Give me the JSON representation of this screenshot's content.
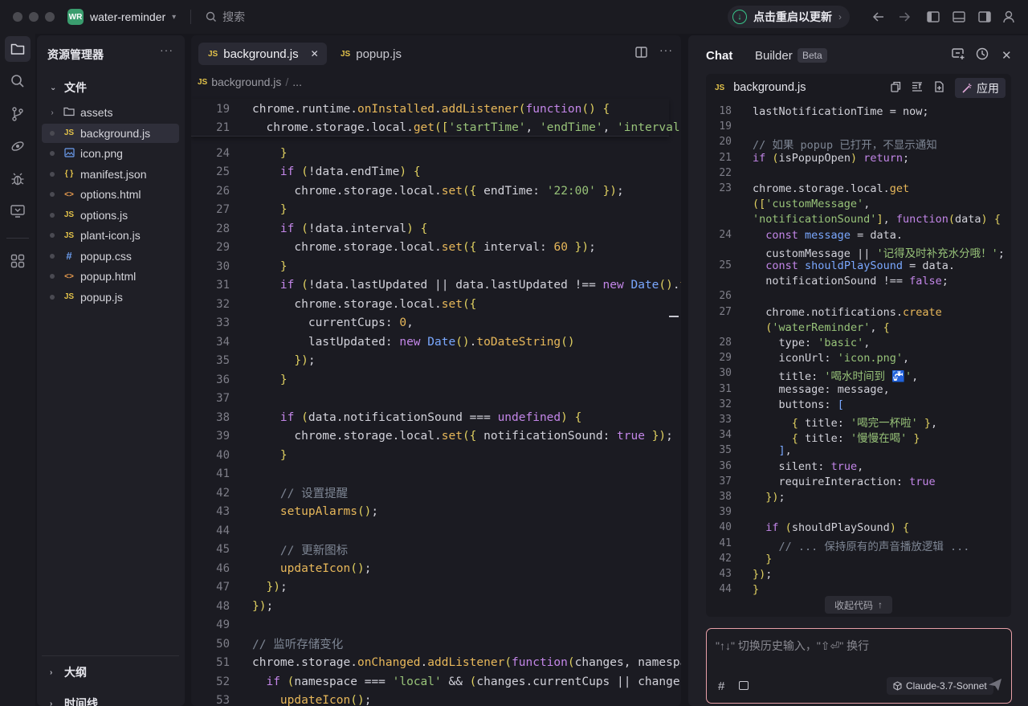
{
  "titlebar": {
    "project_badge": "WR",
    "project_name": "water-reminder",
    "search_placeholder": "搜索",
    "update_label": "点击重启以更新"
  },
  "sidebar": {
    "title": "资源管理器",
    "files_section": "文件",
    "outline_section": "大纲",
    "timeline_section": "时间线",
    "items": [
      {
        "name": "assets",
        "icon": "folder-icon"
      },
      {
        "name": "background.js",
        "icon": "js-file-icon"
      },
      {
        "name": "icon.png",
        "icon": "image-file-icon"
      },
      {
        "name": "manifest.json",
        "icon": "json-file-icon"
      },
      {
        "name": "options.html",
        "icon": "html-file-icon"
      },
      {
        "name": "options.js",
        "icon": "js-file-icon"
      },
      {
        "name": "plant-icon.js",
        "icon": "js-file-icon"
      },
      {
        "name": "popup.css",
        "icon": "css-file-icon"
      },
      {
        "name": "popup.html",
        "icon": "html-file-icon"
      },
      {
        "name": "popup.js",
        "icon": "js-file-icon"
      }
    ]
  },
  "editor": {
    "tabs": [
      {
        "label": "background.js",
        "badge": "JS"
      },
      {
        "label": "popup.js",
        "badge": "JS"
      }
    ],
    "breadcrumb": {
      "file": "background.js",
      "rest": "..."
    },
    "sticky": [
      {
        "ln": "19",
        "html": "<span class='v'>chrome</span>.<span class='v'>runtime</span>.<span class='f'>onInstalled</span>.<span class='f'>addListener</span><span class='p'>(</span><span class='k'>function</span><span class='p'>()</span> <span class='p'>{</span>"
      },
      {
        "ln": "21",
        "html": "  <span class='v'>chrome</span>.<span class='v'>storage</span>.<span class='v'>local</span>.<span class='f'>get</span><span class='p'>([</span><span class='s'>'startTime'</span>, <span class='s'>'endTime'</span>, <span class='s'>'interval'</span>"
      }
    ],
    "lines": [
      {
        "ln": "24",
        "html": "    <span class='p'>}</span>"
      },
      {
        "ln": "25",
        "html": "    <span class='k'>if</span> <span class='p'>(</span>!<span class='v'>data</span>.<span class='v'>endTime</span><span class='p'>)</span> <span class='p'>{</span>"
      },
      {
        "ln": "26",
        "html": "      <span class='v'>chrome</span>.<span class='v'>storage</span>.<span class='v'>local</span>.<span class='f'>set</span><span class='p'>({</span> <span class='v'>endTime</span>: <span class='s'>'22:00'</span> <span class='p'>})</span>;"
      },
      {
        "ln": "27",
        "html": "    <span class='p'>}</span>"
      },
      {
        "ln": "28",
        "html": "    <span class='k'>if</span> <span class='p'>(</span>!<span class='v'>data</span>.<span class='v'>interval</span><span class='p'>)</span> <span class='p'>{</span>"
      },
      {
        "ln": "29",
        "html": "      <span class='v'>chrome</span>.<span class='v'>storage</span>.<span class='v'>local</span>.<span class='f'>set</span><span class='p'>({</span> <span class='v'>interval</span>: <span class='n'>60</span> <span class='p'>})</span>;"
      },
      {
        "ln": "30",
        "html": "    <span class='p'>}</span>"
      },
      {
        "ln": "31",
        "html": "    <span class='k'>if</span> <span class='p'>(</span>!<span class='v'>data</span>.<span class='v'>lastUpdated</span> || <span class='v'>data</span>.<span class='v'>lastUpdated</span> !== <span class='k'>new</span> <span class='b'>Date</span><span class='p'>()</span>.<span class='f'>toD</span>"
      },
      {
        "ln": "32",
        "html": "      <span class='v'>chrome</span>.<span class='v'>storage</span>.<span class='v'>local</span>.<span class='f'>set</span><span class='p'>({</span>"
      },
      {
        "ln": "33",
        "html": "        <span class='v'>currentCups</span>: <span class='n'>0</span>,"
      },
      {
        "ln": "34",
        "html": "        <span class='v'>lastUpdated</span>: <span class='k'>new</span> <span class='b'>Date</span><span class='p'>()</span>.<span class='f'>toDateString</span><span class='p'>()</span>"
      },
      {
        "ln": "35",
        "html": "      <span class='p'>})</span>;"
      },
      {
        "ln": "36",
        "html": "    <span class='p'>}</span>"
      },
      {
        "ln": "37",
        "html": ""
      },
      {
        "ln": "38",
        "html": "    <span class='k'>if</span> <span class='p'>(</span><span class='v'>data</span>.<span class='v'>notificationSound</span> === <span class='k'>undefined</span><span class='p'>)</span> <span class='p'>{</span>"
      },
      {
        "ln": "39",
        "html": "      <span class='v'>chrome</span>.<span class='v'>storage</span>.<span class='v'>local</span>.<span class='f'>set</span><span class='p'>({</span> <span class='v'>notificationSound</span>: <span class='k'>true</span> <span class='p'>})</span>;"
      },
      {
        "ln": "40",
        "html": "    <span class='p'>}</span>"
      },
      {
        "ln": "41",
        "html": ""
      },
      {
        "ln": "42",
        "html": "    <span class='c'>// 设置提醒</span>"
      },
      {
        "ln": "43",
        "html": "    <span class='f'>setupAlarms</span><span class='p'>()</span>;"
      },
      {
        "ln": "44",
        "html": ""
      },
      {
        "ln": "45",
        "html": "    <span class='c'>// 更新图标</span>"
      },
      {
        "ln": "46",
        "html": "    <span class='f'>updateIcon</span><span class='p'>()</span>;"
      },
      {
        "ln": "47",
        "html": "  <span class='p'>})</span>;"
      },
      {
        "ln": "48",
        "html": "<span class='p'>})</span>;"
      },
      {
        "ln": "49",
        "html": ""
      },
      {
        "ln": "50",
        "html": "<span class='c'>// 监听存储变化</span>"
      },
      {
        "ln": "51",
        "html": "<span class='v'>chrome</span>.<span class='v'>storage</span>.<span class='f'>onChanged</span>.<span class='f'>addListener</span><span class='p'>(</span><span class='k'>function</span><span class='p'>(</span><span class='v'>changes</span>, <span class='v'>namespace</span>"
      },
      {
        "ln": "52",
        "html": "  <span class='k'>if</span> <span class='p'>(</span><span class='v'>namespace</span> === <span class='s'>'local'</span> &amp;&amp; <span class='p'>(</span><span class='v'>changes</span>.<span class='v'>currentCups</span> || <span class='v'>changes</span>.<span class='v'>c</span>"
      },
      {
        "ln": "53",
        "html": "    <span class='f'>updateIcon</span><span class='p'>()</span>;"
      }
    ]
  },
  "chat": {
    "tabs": [
      "Chat",
      "Builder"
    ],
    "beta_badge": "Beta",
    "card_filename": "background.js",
    "apply_label": "应用",
    "collapse_label": "收起代码",
    "input_placeholder": "\"↑↓\" 切换历史输入，\"⇧⏎\" 换行",
    "model": "Claude-3.7-Sonnet",
    "lines": [
      {
        "ln": "18",
        "html": "<span class='v'>lastNotificationTime</span> = <span class='v'>now</span>;"
      },
      {
        "ln": "19",
        "html": ""
      },
      {
        "ln": "20",
        "html": "<span class='c'>// 如果 popup 已打开，不显示通知</span>"
      },
      {
        "ln": "21",
        "html": "<span class='k'>if</span> <span class='p'>(</span><span class='v'>isPopupOpen</span><span class='p'>)</span> <span class='k'>return</span>;"
      },
      {
        "ln": "22",
        "html": ""
      },
      {
        "ln": "23",
        "html": "<span class='v'>chrome</span>.<span class='v'>storage</span>.<span class='v'>local</span>.<span class='f'>get</span>"
      },
      {
        "ln": "",
        "html": "<span class='p'>([</span><span class='s'>'customMessage'</span>,"
      },
      {
        "ln": "",
        "html": "<span class='s'>'notificationSound'</span><span class='p'>]</span>, <span class='k'>function</span><span class='p'>(</span><span class='v'>data</span><span class='p'>)</span> <span class='p'>{</span>"
      },
      {
        "ln": "24",
        "html": "  <span class='k'>const</span> <span class='b'>message</span> = <span class='v'>data</span>."
      },
      {
        "ln": "",
        "html": "  <span class='v'>customMessage</span> || <span class='s'>'记得及时补充水分哦！'</span>;"
      },
      {
        "ln": "25",
        "html": "  <span class='k'>const</span> <span class='b'>shouldPlaySound</span> = <span class='v'>data</span>."
      },
      {
        "ln": "",
        "html": "  <span class='v'>notificationSound</span> !== <span class='k'>false</span>;"
      },
      {
        "ln": "26",
        "html": ""
      },
      {
        "ln": "27",
        "html": "  <span class='v'>chrome</span>.<span class='v'>notifications</span>.<span class='f'>create</span>"
      },
      {
        "ln": "",
        "html": "  <span class='p'>(</span><span class='s'>'waterReminder'</span>, <span class='p'>{</span>"
      },
      {
        "ln": "28",
        "html": "    <span class='v'>type</span>: <span class='s'>'basic'</span>,"
      },
      {
        "ln": "29",
        "html": "    <span class='v'>iconUrl</span>: <span class='s'>'icon.png'</span>,"
      },
      {
        "ln": "30",
        "html": "    <span class='v'>title</span>: <span class='s'>'喝水时间到 🚰'</span>,"
      },
      {
        "ln": "31",
        "html": "    <span class='v'>message</span>: <span class='v'>message</span>,"
      },
      {
        "ln": "32",
        "html": "    <span class='v'>buttons</span>: <span class='b'>[</span>"
      },
      {
        "ln": "33",
        "html": "      <span class='p'>{</span> <span class='v'>title</span>: <span class='s'>'喝完一杯啦'</span> <span class='p'>}</span>,"
      },
      {
        "ln": "34",
        "html": "      <span class='p'>{</span> <span class='v'>title</span>: <span class='s'>'慢慢在喝'</span> <span class='p'>}</span>"
      },
      {
        "ln": "35",
        "html": "    <span class='b'>]</span>,"
      },
      {
        "ln": "36",
        "html": "    <span class='v'>silent</span>: <span class='k'>true</span>,"
      },
      {
        "ln": "37",
        "html": "    <span class='v'>requireInteraction</span>: <span class='k'>true</span>"
      },
      {
        "ln": "38",
        "html": "  <span class='p'>})</span>;"
      },
      {
        "ln": "39",
        "html": ""
      },
      {
        "ln": "40",
        "html": "  <span class='k'>if</span> <span class='p'>(</span><span class='v'>shouldPlaySound</span><span class='p'>)</span> <span class='p'>{</span>"
      },
      {
        "ln": "41",
        "html": "    <span class='c'>// ... 保持原有的声音播放逻辑 ...</span>"
      },
      {
        "ln": "42",
        "html": "  <span class='p'>}</span>"
      },
      {
        "ln": "43",
        "html": "<span class='p'>})</span>;"
      },
      {
        "ln": "44",
        "html": "<span class='p'>}</span>"
      }
    ]
  }
}
